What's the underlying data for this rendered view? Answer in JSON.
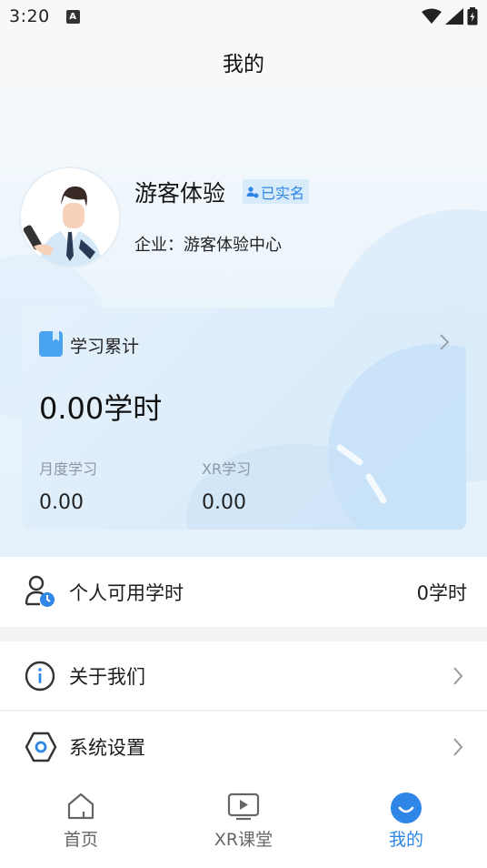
{
  "status_bar": {
    "time": "3:20",
    "notif_icon": "a-icon"
  },
  "header": {
    "title": "我的"
  },
  "profile": {
    "name": "游客体验",
    "verified_label": "已实名",
    "company": "企业：游客体验中心"
  },
  "study_card": {
    "title": "学习累计",
    "total": "0.00学时",
    "monthly_label": "月度学习",
    "monthly_value": "0.00",
    "xr_label": "XR学习",
    "xr_value": "0.00"
  },
  "menu": {
    "personal_hours_label": "个人可用学时",
    "personal_hours_value": "0学时",
    "about_label": "关于我们",
    "settings_label": "系统设置"
  },
  "nav": {
    "home": "首页",
    "xr": "XR课堂",
    "mine": "我的"
  },
  "colors": {
    "accent": "#2f86e6",
    "background": "#f2f3f5"
  }
}
